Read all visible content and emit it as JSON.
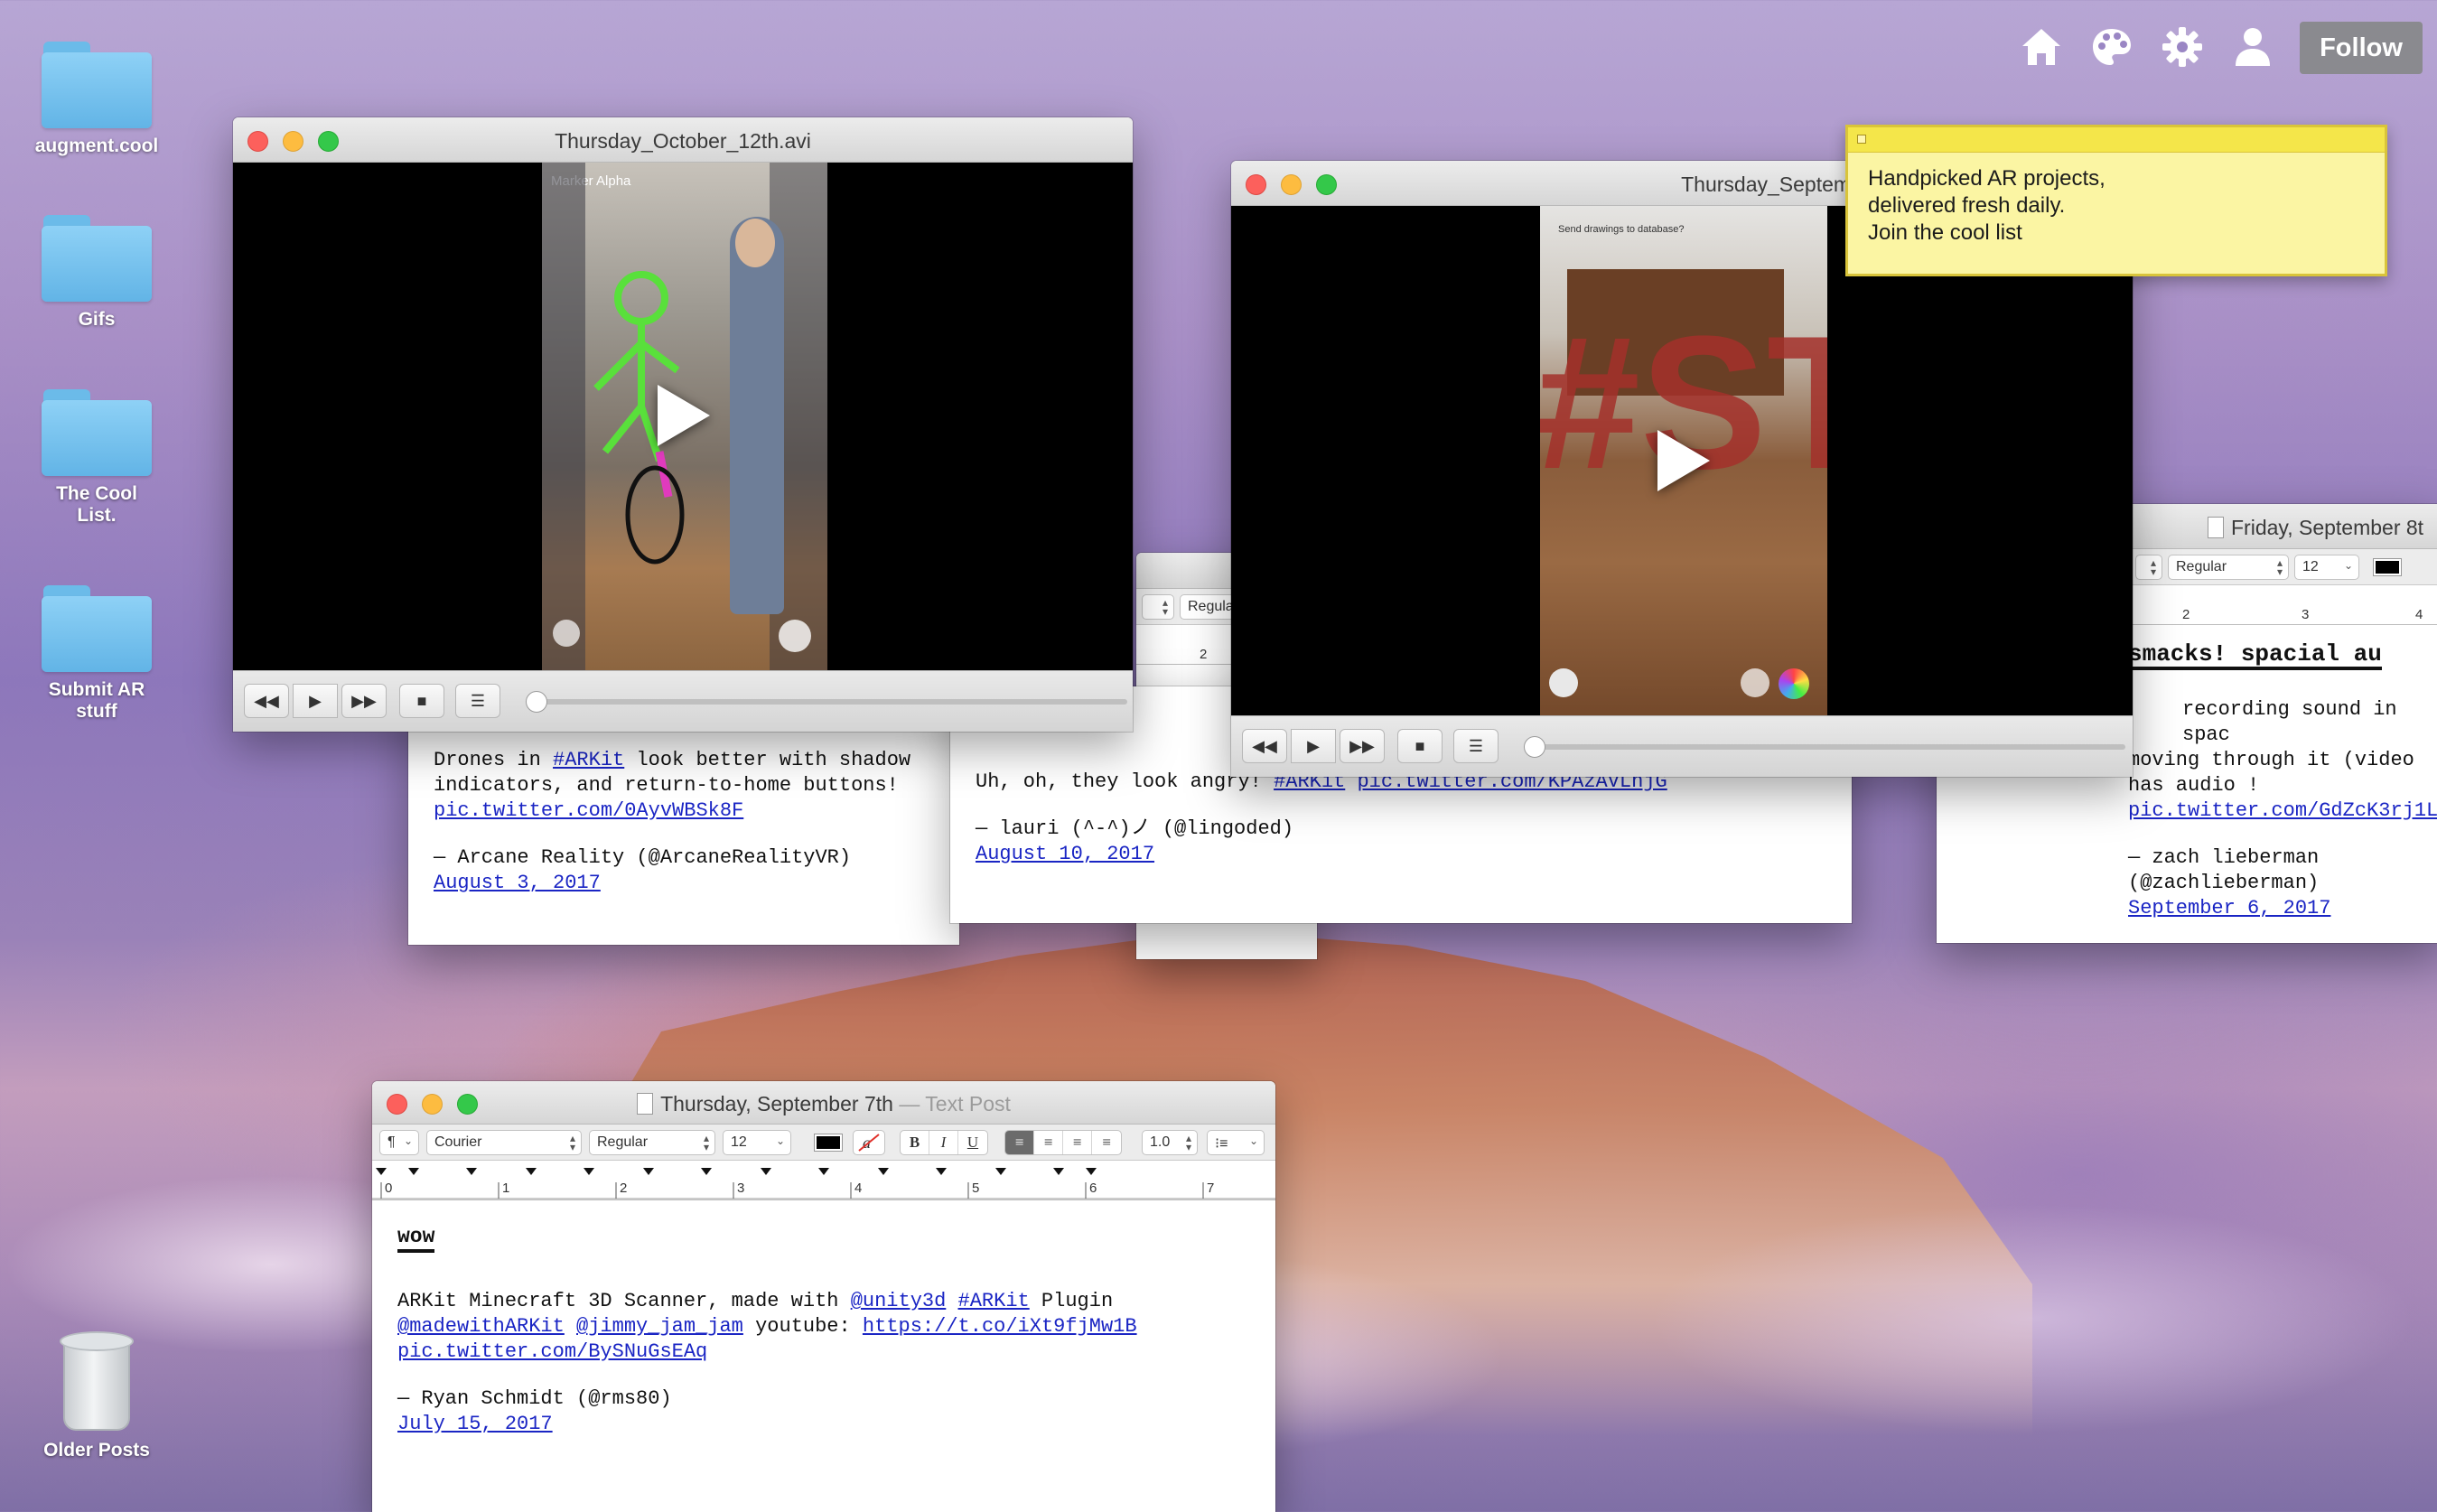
{
  "desktop": {
    "icons": [
      {
        "label": "augment.cool"
      },
      {
        "label": "Gifs"
      },
      {
        "label": "The Cool List."
      },
      {
        "label": "Submit AR stuff"
      }
    ],
    "trash_label": "Older Posts"
  },
  "topbar": {
    "icons": [
      "home-icon",
      "palette-icon",
      "gear-icon",
      "user-icon"
    ],
    "follow_label": "Follow"
  },
  "sticky": {
    "lines": [
      "Handpicked AR projects,",
      "delivered fresh daily.",
      "Join the cool list"
    ]
  },
  "video1": {
    "title": "Thursday_October_12th.avi",
    "overlay_text": "Marker Alpha"
  },
  "video2": {
    "title": "Thursday_September_7th.avi",
    "overlay_text": "Send drawings to database?"
  },
  "post_drones": {
    "line1_pre": "Drones in ",
    "line1_tag": "#ARKit",
    "line1_post": " look better with shadow",
    "line2": "indicators, and return-to-home buttons!",
    "link": "pic.twitter.com/0AyvWBSk8F",
    "author": "— Arcane Reality (@ArcaneRealityVR)",
    "date": "August 3, 2017"
  },
  "post_angry": {
    "line1_pre": "Uh, oh, they look angry! ",
    "line1_tag": "#ARKit",
    "line1_link": "pic.twitter.com/KPAzAVLhjG",
    "author": "— lauri (^-^)ノ (@lingoded)",
    "date": "August 10, 2017"
  },
  "post_friday": {
    "title": "Friday, September 8t",
    "style": "Regular",
    "size": "12",
    "heading": "smacks! spacial au",
    "line1": "recording sound in spac",
    "line2": "moving through it (video has audio !",
    "link": "pic.twitter.com/GdZcK3rj1L",
    "author": "— zach lieberman (@zachlieberman)",
    "date": "September 6, 2017"
  },
  "partial_window": {
    "style": "Regula",
    "ruler_tick": "2"
  },
  "post_main": {
    "title": "Thursday, September 7th",
    "title_sub": "— Text Post",
    "font": "Courier",
    "style": "Regular",
    "size": "12",
    "spacing": "1.0",
    "para_label": "¶",
    "heading": "wow",
    "line1_pre": "ARKit Minecraft 3D Scanner, made with ",
    "line1_m1": "@unity3d",
    "line1_tag": "#ARKit",
    "line1_post": " Plugin",
    "line2_m1": "@madewithARKit",
    "line2_m2": "@jimmy_jam_jam",
    "line2_mid": " youtube: ",
    "line2_link": "https://t.co/iXt9fjMw1B",
    "line3_link": "pic.twitter.com/BySNuGsEAq",
    "author": "— Ryan Schmidt (@rms80)",
    "date": "July 15, 2017",
    "ruler_labels": [
      "0",
      "1",
      "2",
      "3",
      "4",
      "5",
      "6",
      "7"
    ]
  },
  "colors": {
    "link": "#1a25c4",
    "sticky": "#fbf5a3",
    "follow_bg": "#8a8a8f"
  }
}
